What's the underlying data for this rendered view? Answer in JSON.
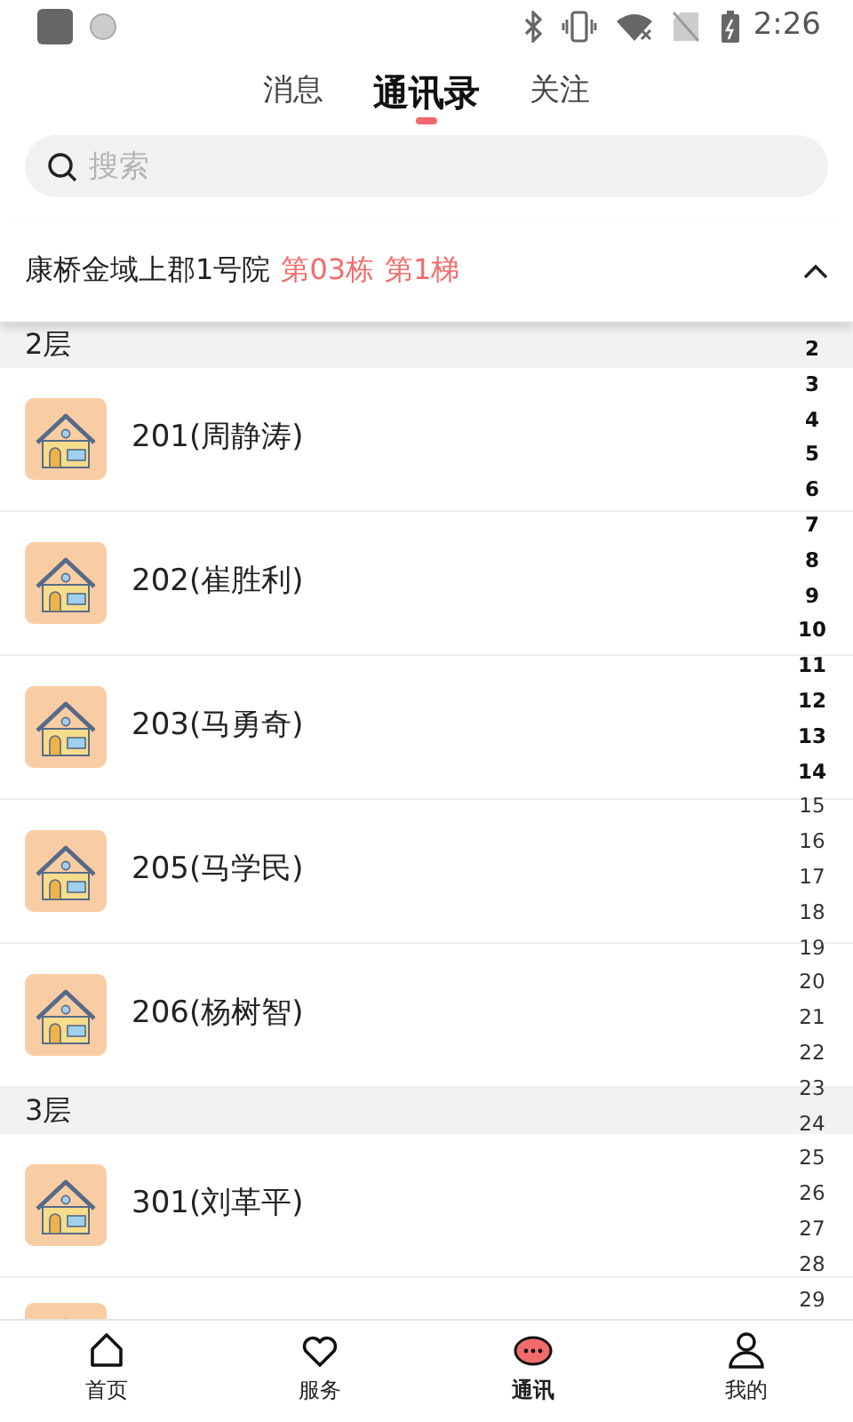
{
  "status_bar": {
    "time": "2:26"
  },
  "tabs": [
    {
      "label": "消息",
      "selected": false
    },
    {
      "label": "通讯录",
      "selected": true
    },
    {
      "label": "关注",
      "selected": false
    }
  ],
  "search": {
    "placeholder": "搜索"
  },
  "location": {
    "community": "康桥金域上郡1号院",
    "building": "第03栋",
    "unit": "第1梯",
    "expanded": true
  },
  "floors": [
    {
      "label": "2层",
      "rooms": [
        {
          "name": "201(周静涛)"
        },
        {
          "name": "202(崔胜利)"
        },
        {
          "name": "203(马勇奇)"
        },
        {
          "name": "205(马学民)"
        },
        {
          "name": "206(杨树智)"
        }
      ]
    },
    {
      "label": "3层",
      "rooms": [
        {
          "name": "301(刘革平)"
        }
      ]
    }
  ],
  "more_below": true,
  "index": [
    {
      "label": "2",
      "highlighted": true
    },
    {
      "label": "3",
      "highlighted": true
    },
    {
      "label": "4",
      "highlighted": true
    },
    {
      "label": "5",
      "highlighted": true
    },
    {
      "label": "6",
      "highlighted": true
    },
    {
      "label": "7",
      "highlighted": true
    },
    {
      "label": "8",
      "highlighted": true
    },
    {
      "label": "9",
      "highlighted": true
    },
    {
      "label": "10",
      "highlighted": true
    },
    {
      "label": "11",
      "highlighted": true
    },
    {
      "label": "12",
      "highlighted": true
    },
    {
      "label": "13",
      "highlighted": true
    },
    {
      "label": "14",
      "highlighted": true
    },
    {
      "label": "15",
      "highlighted": false
    },
    {
      "label": "16",
      "highlighted": false
    },
    {
      "label": "17",
      "highlighted": false
    },
    {
      "label": "18",
      "highlighted": false
    },
    {
      "label": "19",
      "highlighted": false
    },
    {
      "label": "20",
      "highlighted": false
    },
    {
      "label": "21",
      "highlighted": false
    },
    {
      "label": "22",
      "highlighted": false
    },
    {
      "label": "23",
      "highlighted": false
    },
    {
      "label": "24",
      "highlighted": false
    },
    {
      "label": "25",
      "highlighted": false
    },
    {
      "label": "26",
      "highlighted": false
    },
    {
      "label": "27",
      "highlighted": false
    },
    {
      "label": "28",
      "highlighted": false
    },
    {
      "label": "29",
      "highlighted": false
    }
  ],
  "bottom_nav": [
    {
      "label": "首页",
      "kind": "home",
      "selected": false
    },
    {
      "label": "服务",
      "kind": "heart",
      "selected": false
    },
    {
      "label": "通讯",
      "kind": "chat",
      "selected": true
    },
    {
      "label": "我的",
      "kind": "person",
      "selected": false
    }
  ]
}
